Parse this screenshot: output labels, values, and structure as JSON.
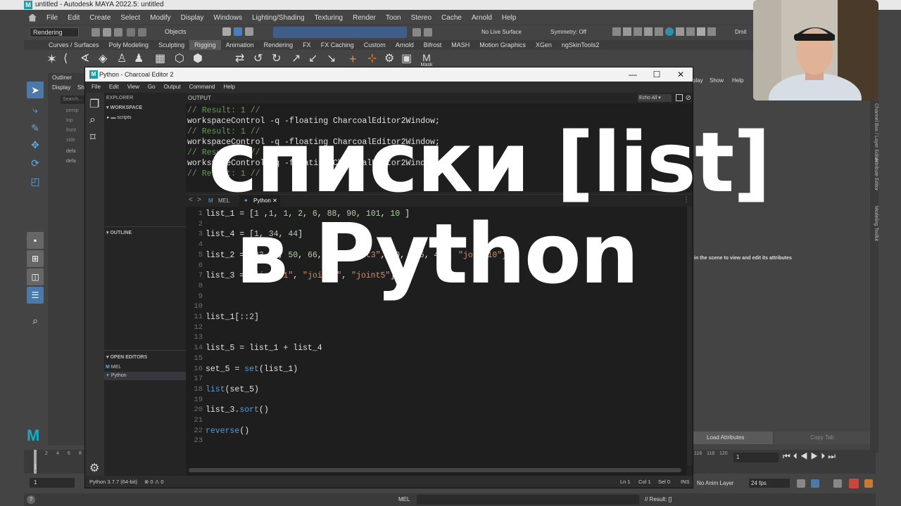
{
  "maya": {
    "title": "untitled - Autodesk MAYA 2022.5: untitled",
    "menu": [
      "File",
      "Edit",
      "Create",
      "Select",
      "Modify",
      "Display",
      "Windows",
      "Lighting/Shading",
      "Texturing",
      "Render",
      "Toon",
      "Stereo",
      "Cache",
      "Arnold",
      "Help"
    ],
    "menu_set": "Rendering",
    "objects_label": "Objects",
    "live_surface": "No Live Surface",
    "symmetry": "Symmetry: Off",
    "user": "Dmit",
    "shelf_tabs": [
      "Curves / Surfaces",
      "Poly Modeling",
      "Sculpting",
      "Rigging",
      "Animation",
      "Rendering",
      "FX",
      "FX Caching",
      "Custom",
      "Arnold",
      "Bifrost",
      "MASH",
      "Motion Graphics",
      "XGen",
      "ngSkinTools2"
    ],
    "active_shelf": "Rigging",
    "mask_label": "Mask",
    "outliner_title": "Outliner",
    "outliner_menu": [
      "Display",
      "Sh"
    ],
    "outliner_search": "Search...",
    "outliner_items": [
      "persp",
      "top",
      "front",
      "side",
      "defa",
      "defa"
    ],
    "panel_menu": [
      "play",
      "Show",
      "Help"
    ],
    "attr_hint": "in the scene to view and edit its attributes",
    "side_tabs": [
      "Channel Box / Layer Editor",
      "Attribute Editor",
      "Modeling Toolkit"
    ],
    "load_attributes": "Load Attributes",
    "copy_tab": "Copy Tab",
    "time_current": "1",
    "time_ticks": [
      "1",
      "2",
      "4",
      "6",
      "8"
    ],
    "time_ticks_right": [
      "116",
      "118",
      "120"
    ],
    "range_start": "1",
    "anim_layer": "No Anim Layer",
    "fps": "24 fps",
    "cmd_mode": "MEL",
    "result": "// Result: []"
  },
  "editor": {
    "title": "Python - Charcoal Editor 2",
    "menu": [
      "File",
      "Edit",
      "View",
      "Go",
      "Output",
      "Command",
      "Help"
    ],
    "explorer_label": "EXPLORER",
    "workspace_label": "WORKSPACE",
    "scripts_folder": "scripts",
    "outline_label": "OUTLINE",
    "open_editors_label": "OPEN EDITORS",
    "open_files": [
      "MEL",
      "Python"
    ],
    "output_label": "OUTPUT",
    "echo": "Echo All",
    "output_lines": [
      {
        "text": "// Result: 1 //",
        "type": "r"
      },
      {
        "text": "workspaceControl -q -floating CharcoalEditor2Window;",
        "type": "c"
      },
      {
        "text": "// Result: 1 //",
        "type": "r"
      },
      {
        "text": "workspaceControl -q -floating CharcoalEditor2Window;",
        "type": "c"
      },
      {
        "text": "// Result: 1 //",
        "type": "r"
      },
      {
        "text": "workspaceControl -q -floating CharcoalEditor2Window;",
        "type": "c"
      },
      {
        "text": "// Result: 1 //",
        "type": "r"
      }
    ],
    "tabs": [
      "MEL",
      "Python"
    ],
    "active_tab": "Python",
    "close_glyph": "✕",
    "code_lines": [
      {
        "n": "1",
        "html": "list_1 = [<span class='n'>1</span> ,<span class='n'>1</span>, <span class='n'>1</span>, <span class='n'>2</span>, <span class='n'>6</span>, <span class='n'>88</span>, <span class='n'>90</span>, <span class='n'>101</span>, <span class='n'>10</span> ]"
      },
      {
        "n": "2",
        "html": ""
      },
      {
        "n": "3",
        "html": "list_4 = [<span class='n'>1</span>, <span class='n'>34</span>, <span class='n'>44</span>]"
      },
      {
        "n": "4",
        "html": ""
      },
      {
        "n": "5",
        "html": "list_2 = [<span class='n'>23</span>, <span class='n'>4</span>, <span class='n'>50</span>, <span class='n'>66</span>, <span class='n'>7</span>, <span class='s'>\"joint3\"</span>, <span class='n'>20</span>, <span class='n'>4.5</span>, <span class='n'>4.0</span>, <span class='s'>\"joint10\"</span>]"
      },
      {
        "n": "6",
        "html": ""
      },
      {
        "n": "7",
        "html": "list_3 = [<span class='s'>\"joint1\"</span>, <span class='s'>\"joint4\"</span>, <span class='s'>\"joint5\"</span>]"
      },
      {
        "n": "8",
        "html": ""
      },
      {
        "n": "9",
        "html": ""
      },
      {
        "n": "10",
        "html": ""
      },
      {
        "n": "11",
        "html": "list_1[::<span class='n'>2</span>]"
      },
      {
        "n": "12",
        "html": ""
      },
      {
        "n": "13",
        "html": ""
      },
      {
        "n": "14",
        "html": "list_5 = list_1 + list_4"
      },
      {
        "n": "15",
        "html": ""
      },
      {
        "n": "16",
        "html": "set_5 = <span class='f'>set</span>(list_1)"
      },
      {
        "n": "17",
        "html": ""
      },
      {
        "n": "18",
        "html": "<span class='f'>list</span>(set_5)"
      },
      {
        "n": "19",
        "html": ""
      },
      {
        "n": "20",
        "html": "list_3.<span class='f'>sort</span>()"
      },
      {
        "n": "21",
        "html": ""
      },
      {
        "n": "22",
        "html": "<span class='f'>reverse</span>()"
      },
      {
        "n": "23",
        "html": ""
      }
    ],
    "status_left": "Python 3.7.7 (64-bit)",
    "problems": "⊗ 0 ⚠ 0",
    "ln": "Ln 1",
    "col": "Col 1",
    "sel": "Sel 0",
    "ins": "INS"
  },
  "overlay": {
    "line1": "списки [list]",
    "line2": "в Python"
  }
}
